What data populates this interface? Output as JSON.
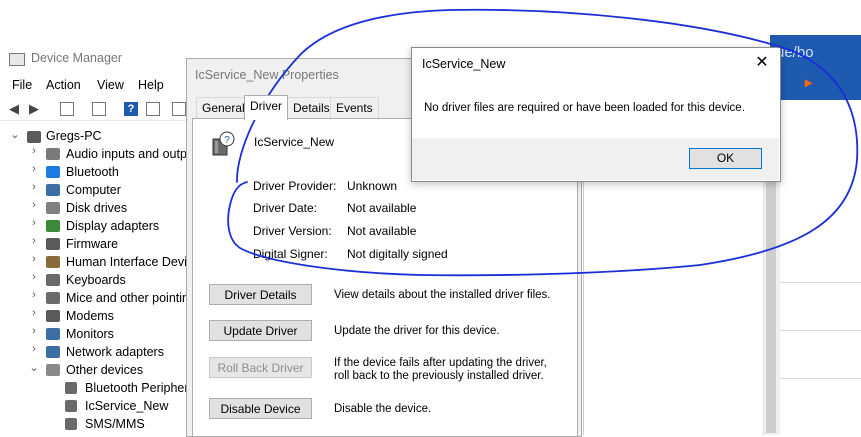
{
  "background_window": {
    "partial_text": "ue/bo",
    "orange_glyph": "▸"
  },
  "device_manager": {
    "title": "Device Manager",
    "menu": [
      "File",
      "Action",
      "View",
      "Help"
    ],
    "tree": {
      "root": "Gregs-PC",
      "categories": [
        "Audio inputs and outp",
        "Bluetooth",
        "Computer",
        "Disk drives",
        "Display adapters",
        "Firmware",
        "Human Interface Devic",
        "Keyboards",
        "Mice and other pointin",
        "Modems",
        "Monitors",
        "Network adapters",
        "Other devices"
      ],
      "other_devices_children": [
        "Bluetooth Periphera",
        "IcService_New",
        "SMS/MMS"
      ]
    }
  },
  "properties_dialog": {
    "title": "IcService_New Properties",
    "tabs": [
      "General",
      "Driver",
      "Details",
      "Events"
    ],
    "active_tab": "Driver",
    "device_name": "IcService_New",
    "fields": [
      {
        "label": "Driver Provider:",
        "value": "Unknown"
      },
      {
        "label": "Driver Date:",
        "value": "Not available"
      },
      {
        "label": "Driver Version:",
        "value": "Not available"
      },
      {
        "label": "Digital Signer:",
        "value": "Not digitally signed"
      }
    ],
    "actions": [
      {
        "button": "Driver Details",
        "description": "View details about the installed driver files.",
        "enabled": true
      },
      {
        "button": "Update Driver",
        "description": "Update the driver for this device.",
        "enabled": true
      },
      {
        "button": "Roll Back Driver",
        "description": "If the device fails after updating the driver, roll back to the previously installed driver.",
        "enabled": false
      },
      {
        "button": "Disable Device",
        "description": "Disable the device.",
        "enabled": true
      }
    ]
  },
  "message_box": {
    "title": "IcService_New",
    "message": "No driver files are required or have been loaded for this device.",
    "ok_label": "OK",
    "close_glyph": "✕"
  },
  "colors": {
    "annotation_ink": "#1a2fd6",
    "accent_blue": "#1e5bb0",
    "focus_border": "#0078d7"
  }
}
